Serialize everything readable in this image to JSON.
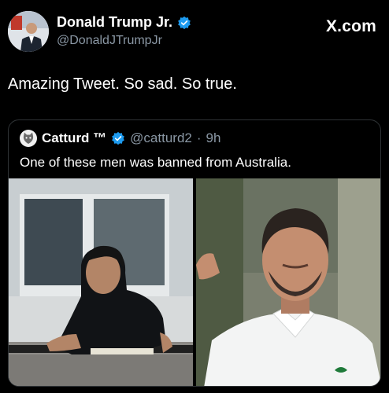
{
  "author": {
    "name": "Donald Trump Jr.",
    "handle": "@DonaldJTrumpJr",
    "verified_color": "#1d9bf0"
  },
  "brand": "X.com",
  "tweet": {
    "text": "Amazing Tweet. So sad. So true."
  },
  "quoted": {
    "name": "Catturd ™",
    "handle": "@catturd2",
    "time": "9h",
    "text": "One of these men was banned from Australia."
  },
  "icons": [
    "verified-badge-icon",
    "cat-avatar-icon"
  ],
  "colors": {
    "background": "#000000",
    "text": "#ffffff",
    "secondary": "#8b98a5",
    "border": "#2f3336"
  }
}
